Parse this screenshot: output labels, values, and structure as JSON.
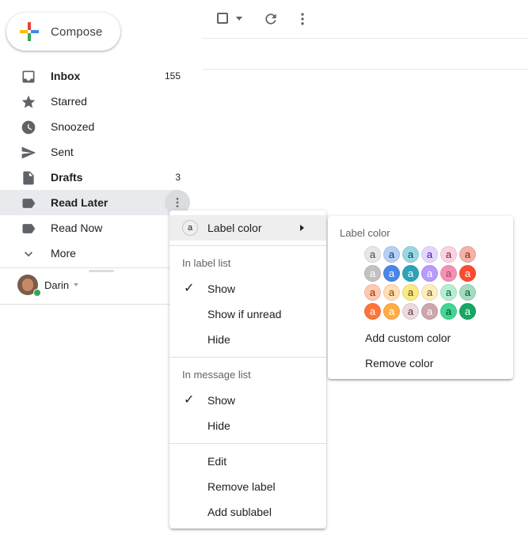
{
  "compose": {
    "label": "Compose"
  },
  "nav": {
    "items": [
      {
        "label": "Inbox",
        "count": "155",
        "icon": "inbox-icon",
        "bold": true
      },
      {
        "label": "Starred",
        "count": "",
        "icon": "star-icon"
      },
      {
        "label": "Snoozed",
        "count": "",
        "icon": "clock-icon"
      },
      {
        "label": "Sent",
        "count": "",
        "icon": "send-icon"
      },
      {
        "label": "Drafts",
        "count": "3",
        "icon": "draft-icon",
        "bold": true
      },
      {
        "label": "Read Later",
        "count": "",
        "icon": "label-icon",
        "bold": true,
        "selected": true
      },
      {
        "label": "Read Now",
        "count": "",
        "icon": "label-icon"
      },
      {
        "label": "More",
        "count": "",
        "icon": "chevron-down-icon"
      }
    ]
  },
  "user": {
    "name": "Darin"
  },
  "menu": {
    "label_color": "Label color",
    "label_color_glyph": "a",
    "in_label_list": "In label list",
    "show": "Show",
    "show_if_unread": "Show if unread",
    "hide": "Hide",
    "in_message_list": "In message list",
    "show2": "Show",
    "hide2": "Hide",
    "edit": "Edit",
    "remove_label": "Remove label",
    "add_sublabel": "Add sublabel"
  },
  "submenu": {
    "title": "Label color",
    "glyph": "a",
    "add_custom": "Add custom color",
    "remove": "Remove color",
    "swatches": [
      [
        {
          "bg": "#e7e7e7",
          "fg": "#464646"
        },
        {
          "bg": "#b6cff5",
          "fg": "#0d3472"
        },
        {
          "bg": "#98d7e4",
          "fg": "#0d3b44"
        },
        {
          "bg": "#e3d7ff",
          "fg": "#3d188e"
        },
        {
          "bg": "#fbd3e0",
          "fg": "#711a36"
        },
        {
          "bg": "#f2b2a8",
          "fg": "#8a1c0a"
        }
      ],
      [
        {
          "bg": "#c2c2c2",
          "fg": "#ffffff"
        },
        {
          "bg": "#4986e7",
          "fg": "#ffffff"
        },
        {
          "bg": "#2da2bb",
          "fg": "#ffffff"
        },
        {
          "bg": "#b99aff",
          "fg": "#ffffff"
        },
        {
          "bg": "#f691b2",
          "fg": "#994a64"
        },
        {
          "bg": "#fb4c2f",
          "fg": "#ffffff"
        }
      ],
      [
        {
          "bg": "#ffc8af",
          "fg": "#7a2e0b"
        },
        {
          "bg": "#ffdeb5",
          "fg": "#7a4706"
        },
        {
          "bg": "#fbe983",
          "fg": "#594c05"
        },
        {
          "bg": "#fdedc1",
          "fg": "#684e07"
        },
        {
          "bg": "#b3efd3",
          "fg": "#0b4f30"
        },
        {
          "bg": "#a2dcc1",
          "fg": "#04502e"
        }
      ],
      [
        {
          "bg": "#ff7537",
          "fg": "#ffffff"
        },
        {
          "bg": "#ffad46",
          "fg": "#ffffff"
        },
        {
          "bg": "#ebdbde",
          "fg": "#662e37"
        },
        {
          "bg": "#cca6ac",
          "fg": "#ffffff"
        },
        {
          "bg": "#42d692",
          "fg": "#094228"
        },
        {
          "bg": "#16a765",
          "fg": "#ffffff"
        }
      ]
    ]
  }
}
